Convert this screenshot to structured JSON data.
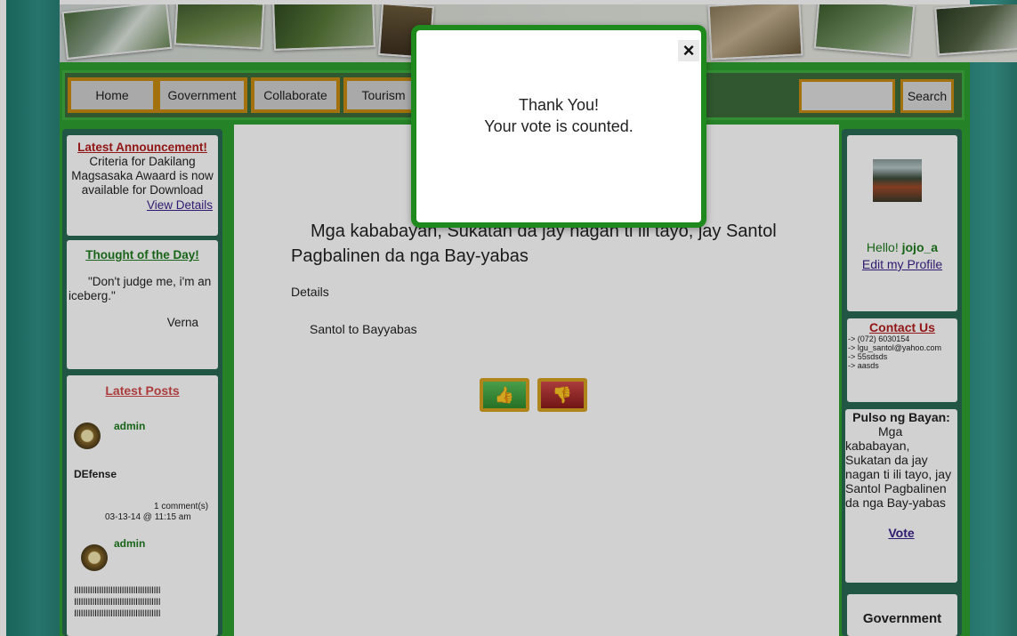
{
  "colors": {
    "accent_green": "#2f9f2f",
    "nav_border": "#c78a12",
    "modal_border": "#1e8a1e",
    "link_red": "#b21b1b",
    "link_green": "#1e7a1e",
    "link_purple": "#3b1f8a",
    "thumb_up": "#3aa33a",
    "thumb_down": "#b02a2a"
  },
  "nav": {
    "items": [
      "Home",
      "Government",
      "Collaborate",
      "Tourism"
    ],
    "search_button": "Search",
    "search_placeholder": ""
  },
  "left": {
    "announcement": {
      "title": "Latest Announcement!",
      "body": "Criteria for Dakilang Magsasaka Awaard is now available for Download",
      "link": "View Details"
    },
    "thought": {
      "title": "Thought of the Day!",
      "quote": "\"Don't judge me, i'm an iceberg.\"",
      "author": "Verna"
    },
    "posts": {
      "title": "Latest Posts",
      "items": [
        {
          "user": "admin",
          "title": "DEfense",
          "comments": "1 comment(s)",
          "date": "03-13-14 @ 11:15 am"
        },
        {
          "user": "admin",
          "title": "IIIIIIIIIIIIIIIIIIIIIIIIIIIIIIIIIIIIII\nIIIIIIIIIIIIIIIIIIIIIIIIIIIIIIIIIIIIII\nIIIIIIIIIIIIIIIIIIIIIIIIIIIIIIIIIIIIII"
        }
      ]
    }
  },
  "main": {
    "question": "Mga kababayan, Sukatan da jay nagan ti ili tayo, jay Santol Pagbalinen da nga Bay-yabas",
    "details_label": "Details",
    "details_text": "Santol to Bayyabas",
    "vote_up_icon": "thumb-up-icon",
    "vote_down_icon": "thumb-down-icon"
  },
  "right": {
    "greeting_prefix": "Hello! ",
    "username": "jojo_a",
    "edit_profile": "Edit my Profile",
    "contact": {
      "title": "Contact Us",
      "lines": [
        "-> (072) 6030154",
        "-> lgu_santol@yahoo.com",
        "-> 55sdsds",
        "-> aasds"
      ]
    },
    "pulso": {
      "title": "Pulso ng Bayan:",
      "text": "Mga kababayan, Sukatan da jay nagan ti ili tayo, jay Santol Pagbalinen da nga Bay-yabas",
      "vote_link": "Vote"
    },
    "government_title": "Government"
  },
  "modal": {
    "close": "×",
    "line1": "Thank You!",
    "line2": "Your vote is counted."
  }
}
